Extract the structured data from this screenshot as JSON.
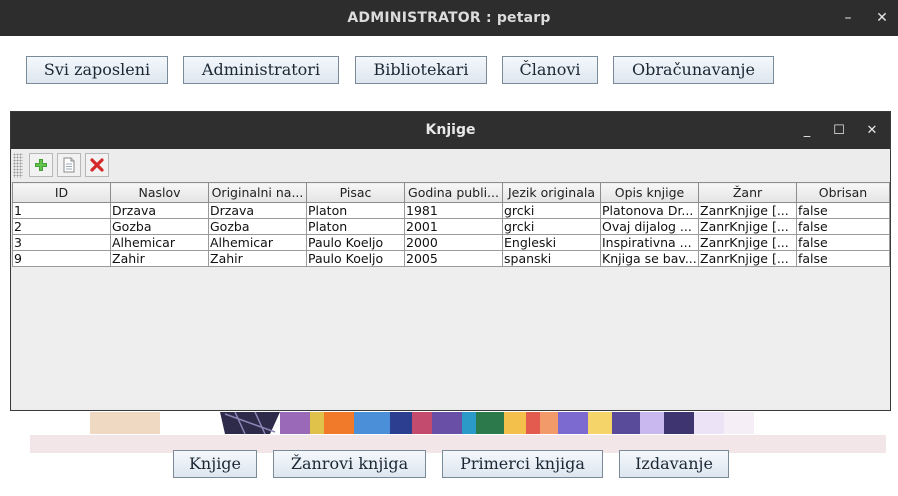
{
  "window": {
    "title": "ADMINISTRATOR : petarp",
    "minimize": "–",
    "close": "✕"
  },
  "top_nav": [
    {
      "label": "Svi zaposleni"
    },
    {
      "label": "Administratori"
    },
    {
      "label": "Bibliotekari"
    },
    {
      "label": "Članovi"
    },
    {
      "label": "Obračunavanje"
    }
  ],
  "bottom_nav": [
    {
      "label": "Knjige"
    },
    {
      "label": "Žanrovi knjiga"
    },
    {
      "label": "Primerci knjiga"
    },
    {
      "label": "Izdavanje"
    }
  ],
  "internal_frame": {
    "title": "Knjige",
    "minimize": "_",
    "maximize": "☐",
    "close": "✕",
    "toolbar": {
      "icons": [
        "add-icon",
        "edit-document-icon",
        "delete-icon"
      ]
    },
    "table": {
      "columns": [
        "ID",
        "Naslov",
        "Originalni na...",
        "Pisac",
        "Godina publi...",
        "Jezik originala",
        "Opis knjige",
        "Žanr",
        "Obrisan"
      ],
      "rows": [
        [
          "1",
          "Drzava",
          "Drzava",
          "Platon",
          "1981",
          "grcki",
          "Platonova Dr...",
          "ZanrKnjige [...",
          "false"
        ],
        [
          "2",
          "Gozba",
          "Gozba",
          "Platon",
          "2001",
          "grcki",
          "Ovaj dijalog ...",
          "ZanrKnjige [...",
          "false"
        ],
        [
          "3",
          "Alhemicar",
          "Alhemicar",
          "Paulo Koeljo",
          "2000",
          "Engleski",
          "Inspirativna ...",
          "ZanrKnjige [...",
          "false"
        ],
        [
          "9",
          "Zahir",
          "Zahir",
          "Paulo Koeljo",
          "2005",
          "spanski",
          "Knjiga se bav...",
          "ZanrKnjige [...",
          "false"
        ]
      ]
    }
  },
  "colors": {
    "titlebar": "#2d2d2d",
    "button_border": "#7a8a99",
    "add_icon": "#3c9a2e",
    "delete_icon": "#d62828"
  }
}
